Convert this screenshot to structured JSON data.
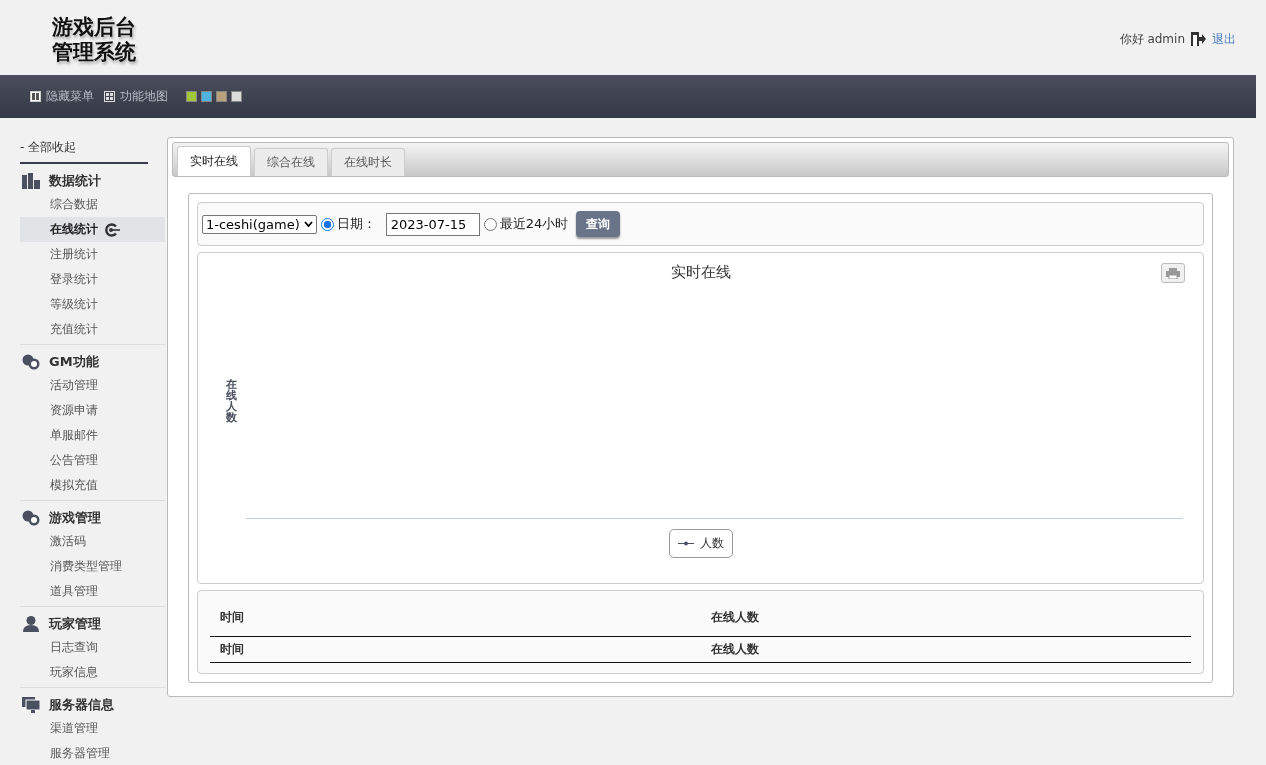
{
  "header": {
    "logo_lines": [
      "游戏后台",
      "管理系统"
    ],
    "greeting": "你好 admin",
    "logout": "退出"
  },
  "toolbar": {
    "items": [
      {
        "label": "隐藏菜单",
        "kind": "columns"
      },
      {
        "label": "功能地图",
        "kind": "grid"
      }
    ],
    "swatches": [
      {
        "color": "#a4c639"
      },
      {
        "color": "#4fb3e0"
      },
      {
        "color": "#b8a07a"
      },
      {
        "color": "#dcdcdc"
      }
    ]
  },
  "sidebar": {
    "collapse_all": "- 全部收起",
    "groups": [
      {
        "title": "数据统计",
        "kind": "bars",
        "items": [
          {
            "label": "综合数据",
            "selected": false
          },
          {
            "label": "在线统计",
            "selected": true
          },
          {
            "label": "注册统计",
            "selected": false
          },
          {
            "label": "登录统计",
            "selected": false
          },
          {
            "label": "等级统计",
            "selected": false
          },
          {
            "label": "充值统计",
            "selected": false
          }
        ]
      },
      {
        "title": "GM功能",
        "kind": "dots",
        "items": [
          {
            "label": "活动管理",
            "selected": false
          },
          {
            "label": "资源申请",
            "selected": false
          },
          {
            "label": "单服邮件",
            "selected": false
          },
          {
            "label": "公告管理",
            "selected": false
          },
          {
            "label": "模拟充值",
            "selected": false
          }
        ]
      },
      {
        "title": "游戏管理",
        "kind": "dots",
        "items": [
          {
            "label": "激活码",
            "selected": false
          },
          {
            "label": "消费类型管理",
            "selected": false
          },
          {
            "label": "道具管理",
            "selected": false
          }
        ]
      },
      {
        "title": "玩家管理",
        "kind": "person",
        "items": [
          {
            "label": "日志查询",
            "selected": false
          },
          {
            "label": "玩家信息",
            "selected": false
          }
        ]
      },
      {
        "title": "服务器信息",
        "kind": "monitor",
        "items": [
          {
            "label": "渠道管理",
            "selected": false
          },
          {
            "label": "服务器管理",
            "selected": false
          }
        ]
      }
    ]
  },
  "tabs": [
    {
      "label": "实时在线",
      "selected": true
    },
    {
      "label": "综合在线",
      "selected": false
    },
    {
      "label": "在线时长",
      "selected": false
    }
  ],
  "query": {
    "server_select": "1-ceshi(game)",
    "date_radio": {
      "label": "日期：",
      "selected": true
    },
    "date_value": "2023-07-15",
    "recent_radio": {
      "label": "最近24小时",
      "selected": false
    },
    "button": "查询"
  },
  "chart": {
    "title": "实时在线",
    "ylabel": "在线人数",
    "legend": [
      {
        "name": "人数"
      }
    ]
  },
  "table": {
    "columns": [
      "时间",
      "在线人数"
    ],
    "footer": [
      "时间",
      "在线人数"
    ]
  }
}
